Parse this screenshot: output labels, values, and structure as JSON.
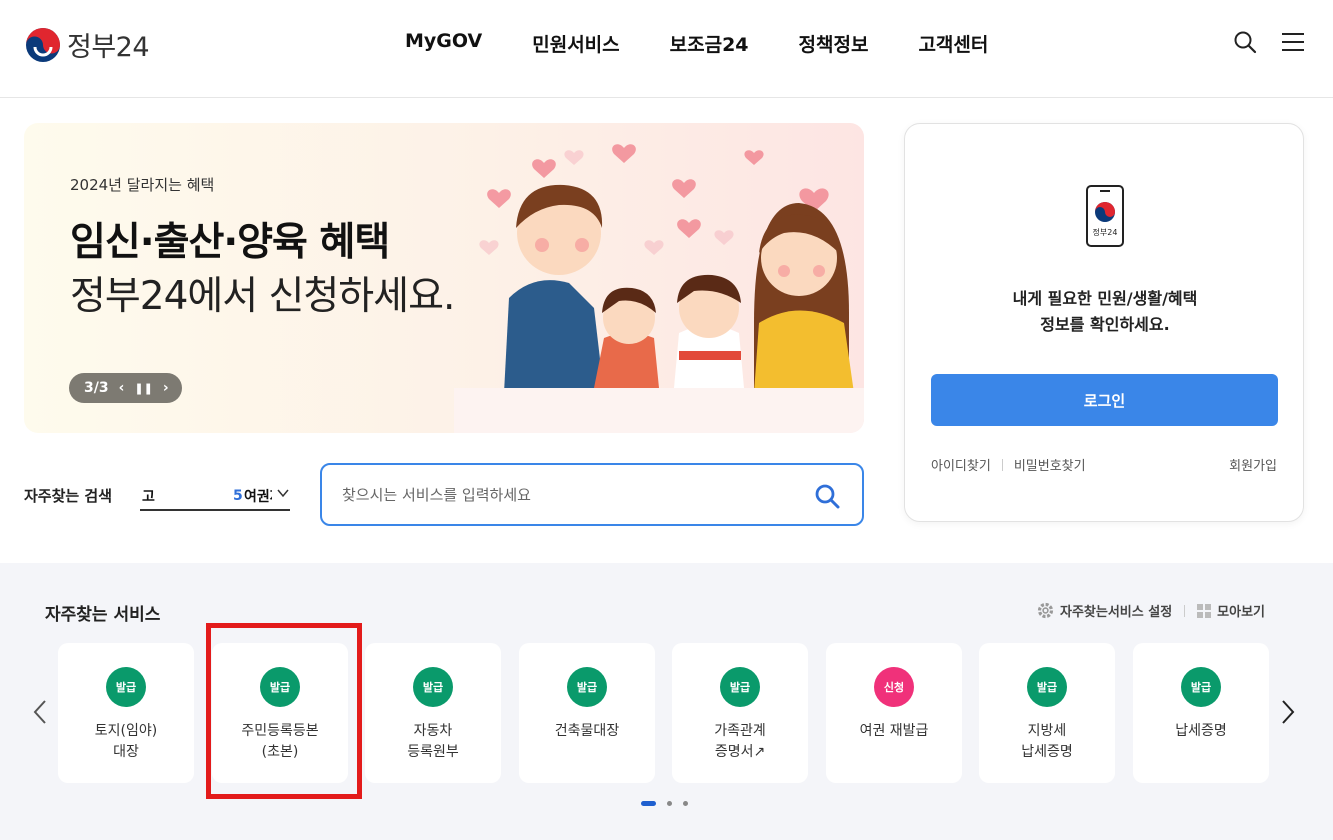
{
  "header": {
    "logo_text": "정부24",
    "nav": [
      "MyGOV",
      "민원서비스",
      "보조금24",
      "정책정보",
      "고객센터"
    ],
    "icons": [
      "search-icon",
      "menu-icon"
    ]
  },
  "banner": {
    "subtitle": "2024년 달라지는 혜택",
    "title": "임신·출산·양육 혜택",
    "description": "정부24에서 신청하세요.",
    "pager": "3/3"
  },
  "login": {
    "phone_label": "정부24",
    "message_line1": "내게 필요한 민원/생활/혜택",
    "message_line2": "정보를 확인하세요.",
    "login_button": "로그인",
    "find_id": "아이디찾기",
    "find_password": "비밀번호찾기",
    "join": "회원가입"
  },
  "search": {
    "label": "자주찾는 검색",
    "rank_keyword": "고",
    "rank_number": "5",
    "rank_term": "여권재",
    "placeholder": "찾으시는 서비스를 입력하세요"
  },
  "services": {
    "title": "자주찾는 서비스",
    "settings_label": "자주찾는서비스 설정",
    "view_all_label": "모아보기",
    "items": [
      {
        "badge": "발급",
        "badge_color": "#0a9a6b",
        "line1": "토지(임야)",
        "line2": "대장"
      },
      {
        "badge": "발급",
        "badge_color": "#0a9a6b",
        "line1": "주민등록등본",
        "line2": "(초본)"
      },
      {
        "badge": "발급",
        "badge_color": "#0a9a6b",
        "line1": "자동차",
        "line2": "등록원부"
      },
      {
        "badge": "발급",
        "badge_color": "#0a9a6b",
        "line1": "건축물대장",
        "line2": ""
      },
      {
        "badge": "발급",
        "badge_color": "#0a9a6b",
        "line1": "가족관계",
        "line2": "증명서↗"
      },
      {
        "badge": "신청",
        "badge_color": "#f0317a",
        "line1": "여권 재발급",
        "line2": ""
      },
      {
        "badge": "발급",
        "badge_color": "#0a9a6b",
        "line1": "지방세",
        "line2": "납세증명"
      },
      {
        "badge": "발급",
        "badge_color": "#0a9a6b",
        "line1": "납세증명",
        "line2": ""
      }
    ],
    "page_count": 3,
    "current_page": 1
  },
  "colors": {
    "primary": "#3a86e8",
    "highlight": "#e31b1b",
    "issue_badge": "#0a9a6b",
    "apply_badge": "#f0317a"
  }
}
